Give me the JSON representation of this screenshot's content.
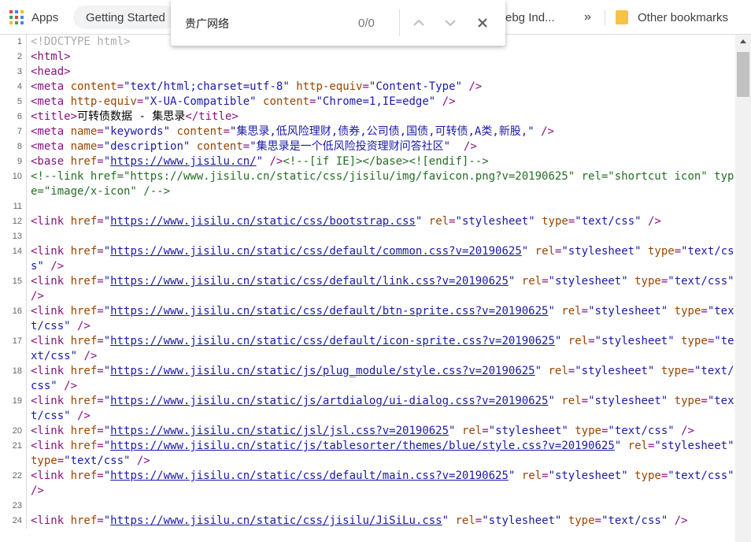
{
  "bookmarks": {
    "apps_label": "Apps",
    "items": [
      {
        "label": "Getting Started",
        "icon": "globe-icon"
      },
      {
        "label": "ebg Ind...",
        "icon": "page-icon"
      }
    ],
    "overflow_label": "»",
    "other_label": "Other bookmarks"
  },
  "find": {
    "query": "贵广网络",
    "count": "0/0"
  },
  "source": {
    "lines": [
      {
        "n": "1",
        "html": "<span class='c-doct'>&lt;!DOCTYPE html&gt;</span>"
      },
      {
        "n": "2",
        "html": "<span class='c-tag'>&lt;html&gt;</span>"
      },
      {
        "n": "3",
        "html": "<span class='c-tag'>&lt;head&gt;</span>"
      },
      {
        "n": "4",
        "html": "<span class='c-tag'>&lt;meta </span><span class='c-attr'>content</span><span class='c-tag'>=</span><span class='c-val'>\"text/html;charset=utf-8\"</span> <span class='c-attr'>http-equiv</span><span class='c-tag'>=</span><span class='c-val'>\"Content-Type\"</span><span class='c-tag'> /&gt;</span>"
      },
      {
        "n": "5",
        "html": "<span class='c-tag'>&lt;meta </span><span class='c-attr'>http-equiv</span><span class='c-tag'>=</span><span class='c-val'>\"X-UA-Compatible\"</span> <span class='c-attr'>content</span><span class='c-tag'>=</span><span class='c-val'>\"Chrome=1,IE=edge\"</span><span class='c-tag'> /&gt;</span>"
      },
      {
        "n": "6",
        "html": "<span class='c-tag'>&lt;title&gt;</span>可转债数据 - 集思录<span class='c-tag'>&lt;/title&gt;</span>"
      },
      {
        "n": "7",
        "html": "<span class='c-tag'>&lt;meta </span><span class='c-attr'>name</span><span class='c-tag'>=</span><span class='c-val'>\"keywords\"</span> <span class='c-attr'>content</span><span class='c-tag'>=</span><span class='c-val'>\"集思录,低风险理财,债券,公司债,国债,可转债,A类,新股,\"</span><span class='c-tag'> /&gt;</span>"
      },
      {
        "n": "8",
        "html": "<span class='c-tag'>&lt;meta </span><span class='c-attr'>name</span><span class='c-tag'>=</span><span class='c-val'>\"description\"</span> <span class='c-attr'>content</span><span class='c-tag'>=</span><span class='c-val'>\"集思录是一个低风险投资理财问答社区\"</span><span class='c-tag'>  /&gt;</span>"
      },
      {
        "n": "9",
        "html": "<span class='c-tag'>&lt;base </span><span class='c-attr'>href</span><span class='c-tag'>=</span><span class='c-val'>\"</span><span class='c-link'>https://www.jisilu.cn/</span><span class='c-val'>\"</span><span class='c-tag'> /&gt;</span><span class='c-com'>&lt;!--[if IE]&gt;&lt;/base&gt;&lt;![endif]--&gt;</span>"
      },
      {
        "n": "10",
        "html": "<span class='c-com'>&lt;!--link href=\"https://www.jisilu.cn/static/css/jisilu/img/favicon.png?v=20190625\" rel=\"shortcut icon\" type=\"image/x-icon\" /--&gt;</span>"
      },
      {
        "n": "11",
        "html": ""
      },
      {
        "n": "12",
        "html": "<span class='c-tag'>&lt;link </span><span class='c-attr'>href</span><span class='c-tag'>=</span><span class='c-val'>\"</span><span class='c-link'>https://www.jisilu.cn/static/css/bootstrap.css</span><span class='c-val'>\"</span> <span class='c-attr'>rel</span><span class='c-tag'>=</span><span class='c-val'>\"stylesheet\"</span> <span class='c-attr'>type</span><span class='c-tag'>=</span><span class='c-val'>\"text/css\"</span><span class='c-tag'> /&gt;</span>"
      },
      {
        "n": "13",
        "html": ""
      },
      {
        "n": "14",
        "html": "<span class='c-tag'>&lt;link </span><span class='c-attr'>href</span><span class='c-tag'>=</span><span class='c-val'>\"</span><span class='c-link'>https://www.jisilu.cn/static/css/default/common.css?v=20190625</span><span class='c-val'>\"</span> <span class='c-attr'>rel</span><span class='c-tag'>=</span><span class='c-val'>\"stylesheet\"</span> <span class='c-attr'>type</span><span class='c-tag'>=</span><span class='c-val'>\"text/css\"</span><span class='c-tag'> /&gt;</span>"
      },
      {
        "n": "15",
        "html": "<span class='c-tag'>&lt;link </span><span class='c-attr'>href</span><span class='c-tag'>=</span><span class='c-val'>\"</span><span class='c-link'>https://www.jisilu.cn/static/css/default/link.css?v=20190625</span><span class='c-val'>\"</span> <span class='c-attr'>rel</span><span class='c-tag'>=</span><span class='c-val'>\"stylesheet\"</span> <span class='c-attr'>type</span><span class='c-tag'>=</span><span class='c-val'>\"text/css\"</span><span class='c-tag'> /&gt;</span>"
      },
      {
        "n": "16",
        "html": "<span class='c-tag'>&lt;link </span><span class='c-attr'>href</span><span class='c-tag'>=</span><span class='c-val'>\"</span><span class='c-link'>https://www.jisilu.cn/static/css/default/btn-sprite.css?v=20190625</span><span class='c-val'>\"</span> <span class='c-attr'>rel</span><span class='c-tag'>=</span><span class='c-val'>\"stylesheet\"</span> <span class='c-attr'>type</span><span class='c-tag'>=</span><span class='c-val'>\"text/css\"</span><span class='c-tag'> /&gt;</span>"
      },
      {
        "n": "17",
        "html": "<span class='c-tag'>&lt;link </span><span class='c-attr'>href</span><span class='c-tag'>=</span><span class='c-val'>\"</span><span class='c-link'>https://www.jisilu.cn/static/css/default/icon-sprite.css?v=20190625</span><span class='c-val'>\"</span> <span class='c-attr'>rel</span><span class='c-tag'>=</span><span class='c-val'>\"stylesheet\"</span> <span class='c-attr'>type</span><span class='c-tag'>=</span><span class='c-val'>\"text/css\"</span><span class='c-tag'> /&gt;</span>"
      },
      {
        "n": "18",
        "html": "<span class='c-tag'>&lt;link </span><span class='c-attr'>href</span><span class='c-tag'>=</span><span class='c-val'>\"</span><span class='c-link'>https://www.jisilu.cn/static/js/plug_module/style.css?v=20190625</span><span class='c-val'>\"</span> <span class='c-attr'>rel</span><span class='c-tag'>=</span><span class='c-val'>\"stylesheet\"</span> <span class='c-attr'>type</span><span class='c-tag'>=</span><span class='c-val'>\"text/css\"</span><span class='c-tag'> /&gt;</span>"
      },
      {
        "n": "19",
        "html": "<span class='c-tag'>&lt;link </span><span class='c-attr'>href</span><span class='c-tag'>=</span><span class='c-val'>\"</span><span class='c-link'>https://www.jisilu.cn/static/js/artdialog/ui-dialog.css?v=20190625</span><span class='c-val'>\"</span> <span class='c-attr'>rel</span><span class='c-tag'>=</span><span class='c-val'>\"stylesheet\"</span> <span class='c-attr'>type</span><span class='c-tag'>=</span><span class='c-val'>\"text/css\"</span><span class='c-tag'> /&gt;</span>"
      },
      {
        "n": "20",
        "html": "<span class='c-tag'>&lt;link </span><span class='c-attr'>href</span><span class='c-tag'>=</span><span class='c-val'>\"</span><span class='c-link'>https://www.jisilu.cn/static/jsl/jsl.css?v=20190625</span><span class='c-val'>\"</span> <span class='c-attr'>rel</span><span class='c-tag'>=</span><span class='c-val'>\"stylesheet\"</span> <span class='c-attr'>type</span><span class='c-tag'>=</span><span class='c-val'>\"text/css\"</span><span class='c-tag'> /&gt;</span>"
      },
      {
        "n": "21",
        "html": "<span class='c-tag'>&lt;link </span><span class='c-attr'>href</span><span class='c-tag'>=</span><span class='c-val'>\"</span><span class='c-link'>https://www.jisilu.cn/static/js/tablesorter/themes/blue/style.css?v=20190625</span><span class='c-val'>\"</span> <span class='c-attr'>rel</span><span class='c-tag'>=</span><span class='c-val'>\"stylesheet\"</span> <span class='c-attr'>type</span><span class='c-tag'>=</span><span class='c-val'>\"text/css\"</span><span class='c-tag'> /&gt;</span>"
      },
      {
        "n": "22",
        "html": "<span class='c-tag'>&lt;link </span><span class='c-attr'>href</span><span class='c-tag'>=</span><span class='c-val'>\"</span><span class='c-link'>https://www.jisilu.cn/static/css/default/main.css?v=20190625</span><span class='c-val'>\"</span> <span class='c-attr'>rel</span><span class='c-tag'>=</span><span class='c-val'>\"stylesheet\"</span> <span class='c-attr'>type</span><span class='c-tag'>=</span><span class='c-val'>\"text/css\"</span><span class='c-tag'> /&gt;</span>"
      },
      {
        "n": "23",
        "html": ""
      },
      {
        "n": "24",
        "html": "<span class='c-tag'>&lt;link </span><span class='c-attr'>href</span><span class='c-tag'>=</span><span class='c-val'>\"</span><span class='c-link'>https://www.jisilu.cn/static/css/jisilu/JiSiLu.css</span><span class='c-val'>\"</span> <span class='c-attr'>rel</span><span class='c-tag'>=</span><span class='c-val'>\"stylesheet\"</span> <span class='c-attr'>type</span><span class='c-tag'>=</span><span class='c-val'>\"text/css\"</span><span class='c-tag'> /&gt;</span>"
      }
    ]
  },
  "colors": {
    "tag": "#881280",
    "attribute": "#994500",
    "value": "#1a1aa6",
    "comment": "#236e25",
    "doctype": "#aaaaaa",
    "folder": "#f6c344"
  }
}
